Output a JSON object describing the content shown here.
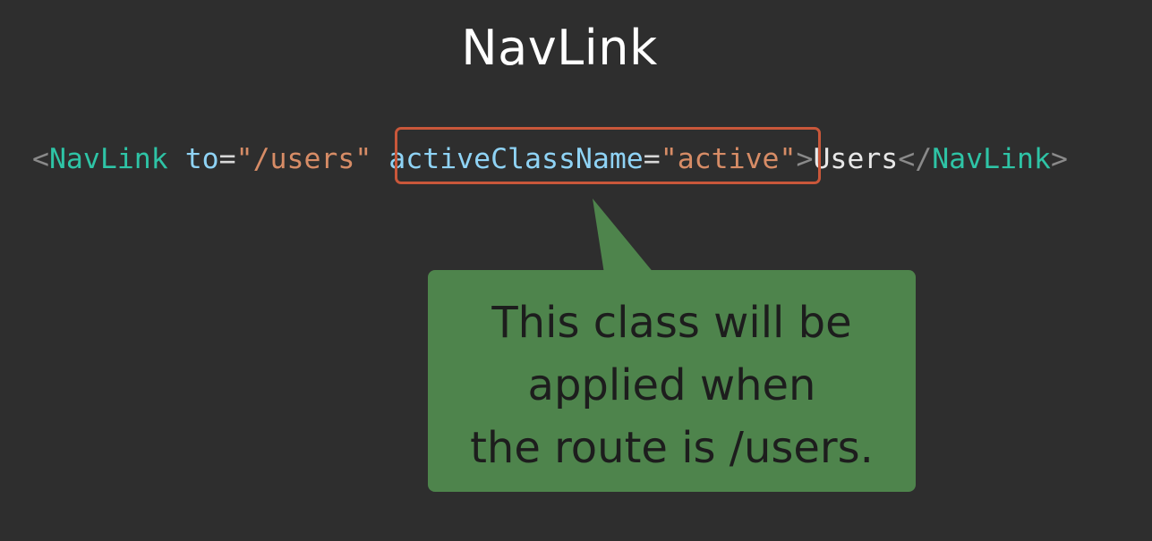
{
  "slide": {
    "title": "NavLink",
    "background_color": "#2e2e2e"
  },
  "code": {
    "open_bracket": "<",
    "tag_name": "NavLink",
    "attr_to": "to",
    "equals": "=",
    "value_to": "\"/users\"",
    "attr_active": "activeClassName",
    "value_active": "\"active\"",
    "close_bracket": ">",
    "inner_text": "Users",
    "end_open_bracket": "</",
    "end_tag_name": "NavLink",
    "end_close_bracket": ">"
  },
  "callout": {
    "lines": [
      "This class will be",
      "applied when",
      "the route is /users."
    ],
    "color": "#4e844c"
  },
  "highlight": {
    "color": "#c9573a"
  }
}
